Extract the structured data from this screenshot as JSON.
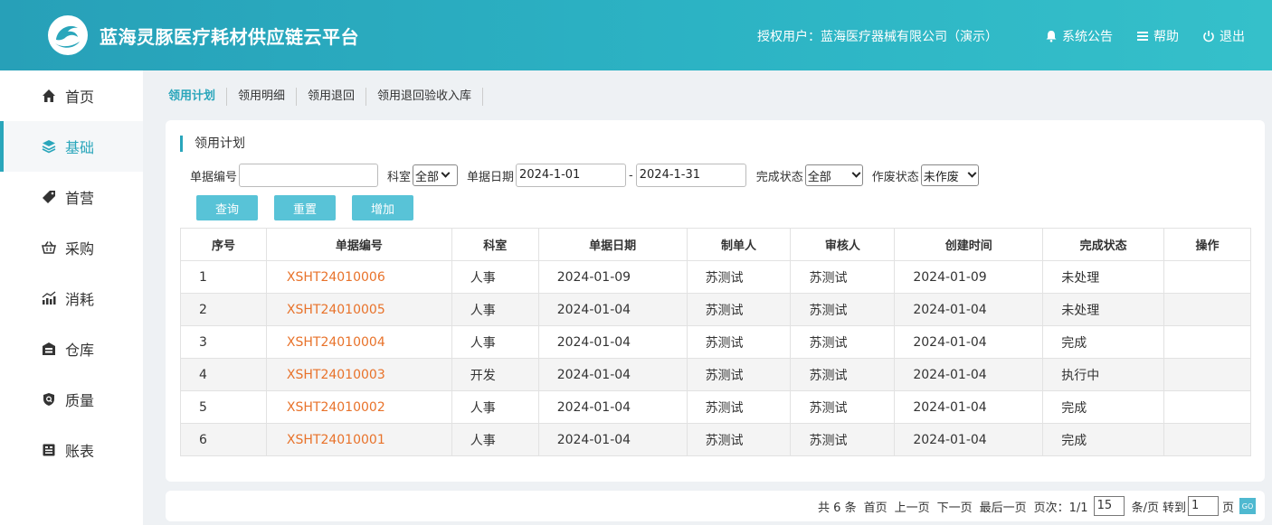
{
  "header": {
    "title": "蓝海灵豚医疗耗材供应链云平台",
    "user": "授权用户：蓝海医疗器械有限公司（演示）",
    "notice": "系统公告",
    "help": "帮助",
    "logout": "退出"
  },
  "sidebar": {
    "items": [
      {
        "label": "首页",
        "icon": "home-icon"
      },
      {
        "label": "基础",
        "icon": "layers-icon",
        "active": true
      },
      {
        "label": "首营",
        "icon": "tag-icon"
      },
      {
        "label": "采购",
        "icon": "basket-icon"
      },
      {
        "label": "消耗",
        "icon": "chart-icon"
      },
      {
        "label": "仓库",
        "icon": "warehouse-icon"
      },
      {
        "label": "质量",
        "icon": "shield-icon"
      },
      {
        "label": "账表",
        "icon": "ledger-icon"
      }
    ]
  },
  "subnav": {
    "tabs": [
      "领用计划",
      "领用明细",
      "领用退回",
      "领用退回验收入库"
    ]
  },
  "panel": {
    "title": "领用计划",
    "filters": {
      "doc_no_label": "单据编号",
      "doc_no_value": "",
      "dept_label": "科室",
      "dept_value": "全部",
      "date_label": "单据日期",
      "date_from": "2024-1-01",
      "date_sep": "-",
      "date_to": "2024-1-31",
      "status_label": "完成状态",
      "status_value": "全部",
      "void_label": "作废状态",
      "void_value": "未作废"
    },
    "buttons": {
      "query": "查询",
      "reset": "重置",
      "add": "增加"
    }
  },
  "table": {
    "headers": [
      "序号",
      "单据编号",
      "科室",
      "单据日期",
      "制单人",
      "审核人",
      "创建时间",
      "完成状态",
      "操作"
    ],
    "rows": [
      [
        "1",
        "XSHT24010006",
        "人事",
        "2024-01-09",
        "苏测试",
        "苏测试",
        "2024-01-09",
        "未处理",
        ""
      ],
      [
        "2",
        "XSHT24010005",
        "人事",
        "2024-01-04",
        "苏测试",
        "苏测试",
        "2024-01-04",
        "未处理",
        ""
      ],
      [
        "3",
        "XSHT24010004",
        "人事",
        "2024-01-04",
        "苏测试",
        "苏测试",
        "2024-01-04",
        "完成",
        ""
      ],
      [
        "4",
        "XSHT24010003",
        "开发",
        "2024-01-04",
        "苏测试",
        "苏测试",
        "2024-01-04",
        "执行中",
        ""
      ],
      [
        "5",
        "XSHT24010002",
        "人事",
        "2024-01-04",
        "苏测试",
        "苏测试",
        "2024-01-04",
        "完成",
        ""
      ],
      [
        "6",
        "XSHT24010001",
        "人事",
        "2024-01-04",
        "苏测试",
        "苏测试",
        "2024-01-04",
        "完成",
        ""
      ]
    ]
  },
  "pager": {
    "total": "共 6 条",
    "first": "首页",
    "prev": "上一页",
    "next": "下一页",
    "last": "最后一页",
    "page_info": "页次：1/1",
    "page_size": "15",
    "per_page": "条/页",
    "goto_label": "转到",
    "goto_value": "1",
    "page_unit": "页",
    "go": "GO"
  },
  "colors": {
    "accent": "#2aa6bb",
    "button": "#58c3d7",
    "link": "#e8722a"
  }
}
